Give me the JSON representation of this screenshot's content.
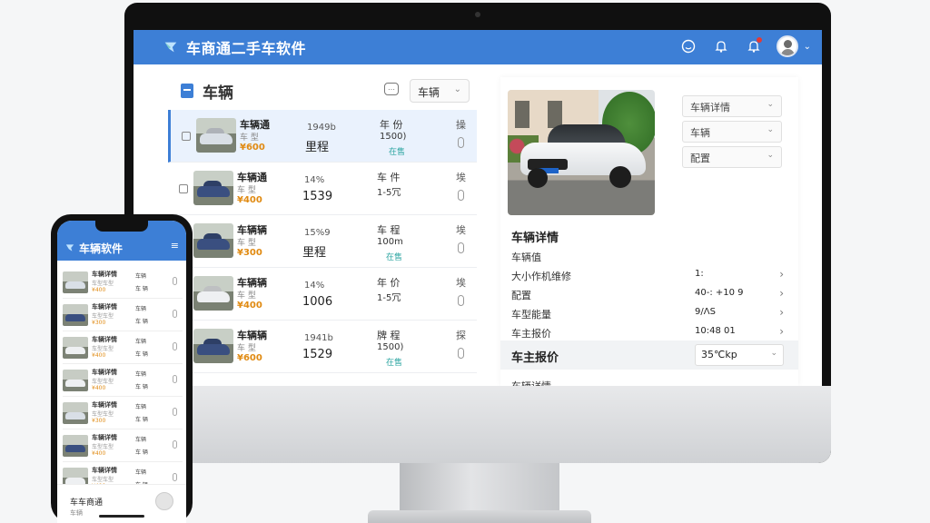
{
  "app": {
    "title": "车商通二手车软件"
  },
  "topbar": {
    "icons": [
      "smile-icon",
      "bell-icon",
      "notification-bell-icon",
      "user-avatar"
    ]
  },
  "colors": {
    "primary": "#3d7fd6",
    "price": "#e08a12",
    "accent_teal": "#2aa4a0",
    "badge": "#e53935"
  },
  "left_panel": {
    "title": "车辆",
    "filter_select": "车辆",
    "vehicles": [
      {
        "name": "车辆通",
        "sub": "车 型",
        "price": "¥600",
        "c1": "1949b",
        "c1b": "里程",
        "c2": "年 份",
        "c2b": "1500)",
        "c2c": "在售",
        "tool": "操",
        "color": "#d9dfe6"
      },
      {
        "name": "车辆通",
        "sub": "车 型",
        "price": "¥400",
        "c1": "14%",
        "c1b": "1539",
        "c2": "车 件",
        "c2b": "1-5冗",
        "c2c": "",
        "tool": "埃",
        "color": "#3a4f80"
      },
      {
        "name": "车辆辆",
        "sub": "车 型",
        "price": "¥300",
        "c1": "15%9",
        "c1b": "里程",
        "c2": "车 程",
        "c2b": "100m",
        "c2c": "在售",
        "tool": "埃",
        "color": "#3a4f80"
      },
      {
        "name": "车辆辆",
        "sub": "车 型",
        "price": "¥400",
        "c1": "14%",
        "c1b": "1006",
        "c2": "年 价",
        "c2b": "1-5冗",
        "c2c": "",
        "tool": "埃",
        "color": "#eef0f2"
      },
      {
        "name": "车辆辆",
        "sub": "车 型",
        "price": "¥600",
        "c1": "1941b",
        "c1b": "1529",
        "c2": "牌 程",
        "c2b": "1500)",
        "c2c": "在售",
        "tool": "探",
        "color": "#3a4f80"
      }
    ]
  },
  "right_panel": {
    "selects": [
      "车辆详情",
      "车辆",
      "配置"
    ],
    "detail_title": "车辆详情",
    "rows": [
      {
        "k": "车辆值",
        "v": "",
        "arrow": false
      },
      {
        "k": "大小作机维修",
        "v": "1:",
        "arrow": true
      },
      {
        "k": "配置",
        "v": "40-: +10 9",
        "arrow": true
      },
      {
        "k": "车型能量",
        "v": "9/ΛS",
        "arrow": true
      },
      {
        "k": "车主报价",
        "v": "10:48 01",
        "arrow": true
      }
    ],
    "owner_price": {
      "label": "车主报价",
      "value": "35℃kp"
    },
    "cut_label": "车辆详情"
  },
  "phone": {
    "title": "车辆软件",
    "menu_icon": "≡",
    "rows": [
      {
        "name": "车辆详情",
        "sub": "车型车型",
        "price": "¥400",
        "c1": "车辆",
        "c2": "车 辆",
        "color": "#d9dfe6"
      },
      {
        "name": "车辆详情",
        "sub": "车型车型",
        "price": "¥300",
        "c1": "车辆",
        "c2": "车 辆",
        "color": "#3a4f80"
      },
      {
        "name": "车辆详情",
        "sub": "车型车型",
        "price": "¥400",
        "c1": "车辆",
        "c2": "车 辆",
        "color": "#eef0f2"
      },
      {
        "name": "车辆详情",
        "sub": "车型车型",
        "price": "¥400",
        "c1": "车辆",
        "c2": "车 辆",
        "color": "#eef0f2"
      },
      {
        "name": "车辆详情",
        "sub": "车型车型",
        "price": "¥300",
        "c1": "车辆",
        "c2": "车 辆",
        "color": "#d9dfe6"
      },
      {
        "name": "车辆详情",
        "sub": "车型车型",
        "price": "¥400",
        "c1": "车辆",
        "c2": "车 辆",
        "color": "#3a4f80"
      },
      {
        "name": "车辆详情",
        "sub": "车型车型",
        "price": "¥400",
        "c1": "车辆",
        "c2": "车 辆",
        "color": "#eef0f2"
      }
    ],
    "footer_label": "车车商通",
    "footer_sub": "车辆"
  }
}
